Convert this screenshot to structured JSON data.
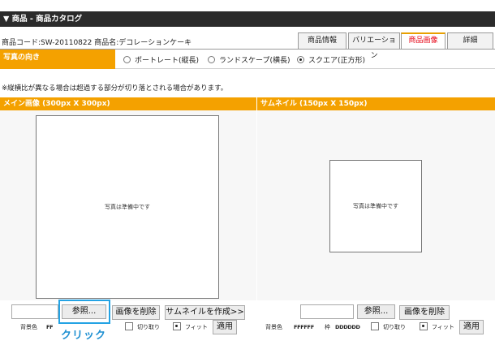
{
  "title": "▼ 商品 - 商品カタログ",
  "product": {
    "code_label": "商品コード:",
    "code": "SW-20110822",
    "name_label": "商品名:",
    "name": "デコレーションケーキ"
  },
  "tabs": [
    {
      "label": "商品情報",
      "active": false
    },
    {
      "label": "バリエーション",
      "active": false
    },
    {
      "label": "商品画像",
      "active": true
    },
    {
      "label": "詳細",
      "active": false
    }
  ],
  "orientation": {
    "label": "写真の向き",
    "options": [
      {
        "label": "ポートレート(縦長)",
        "selected": false
      },
      {
        "label": "ランドスケープ(横長)",
        "selected": false
      },
      {
        "label": "スクエア(正方形)",
        "selected": true
      }
    ]
  },
  "notice": "※縦横比が異なる場合は超過する部分が切り落とされる場合があります。",
  "main_image": {
    "header": "メイン画像 (300px X 300px)",
    "placeholder": "写真は準備中です",
    "browse": "参照...",
    "delete": "画像を削除",
    "make_thumb": "サムネイルを作成>>",
    "bg_label": "背景色",
    "bg_value": "FF",
    "crop_label": "切り取り",
    "fit_label": "フィット",
    "apply": "適用"
  },
  "thumbnail": {
    "header": "サムネイル (150px X 150px)",
    "placeholder": "写真は準備中です",
    "browse": "参照...",
    "delete": "画像を削除",
    "bg_label": "背景色",
    "bg_value": "FFFFFF",
    "frame_label": "枠",
    "frame_value": "DDDDDD",
    "crop_label": "切り取り",
    "fit_label": "フィット",
    "apply": "適用"
  },
  "callout": "クリック",
  "colors": {
    "orange": "#f4a100",
    "title_bar": "#2b2b2b",
    "active_tab": "#e60012",
    "callout": "#1d8fd1"
  }
}
